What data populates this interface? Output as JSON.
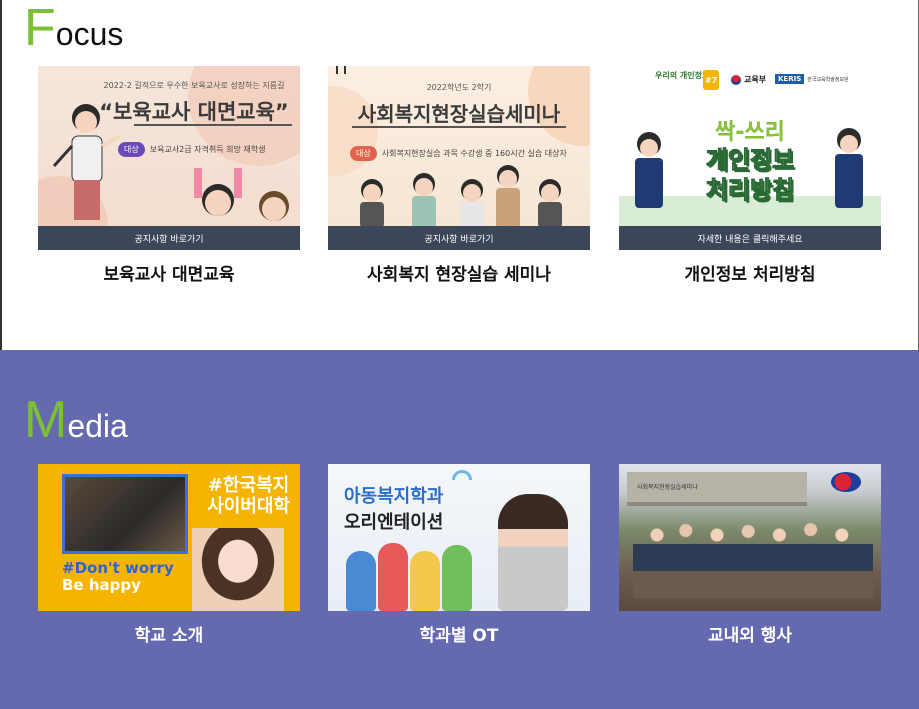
{
  "focus": {
    "title_initial": "F",
    "title_rest": "ocus",
    "cards": [
      {
        "sub_small": "2022-2 길적으로 우수한 보육교사로 성장하는 지름길",
        "headline": "“보육교사 대면교육”",
        "tag": "대상",
        "tag_text": "보육교사2급 자격취득 희망 재학생",
        "strip": "공지사항 바로가기",
        "caption": "보육교사 대면교육"
      },
      {
        "sub_small": "2022학년도 2학기",
        "headline": "사회복지현장실습세미나",
        "tag": "대상",
        "tag_text": "사회복지현장실습 과목 수강생 중 160시간 실습 대상자",
        "strip": "공지사항 바로가기",
        "caption": "사회복지 현장실습 세미나"
      },
      {
        "badge_top": "우리의 개인정보",
        "badge_num": "#7",
        "org1": "교육부",
        "org2": "KERIS",
        "org2_sub": "한국교육학술정보원",
        "headline1": "싹-쓰리",
        "headline2": "개인정보",
        "headline3": "처리방침",
        "strip": "자세한 내용은 클릭해주세요",
        "caption": "개인정보 처리방침"
      }
    ]
  },
  "media": {
    "title_initial": "M",
    "title_rest": "edia",
    "cards": [
      {
        "hash1_l1": "#한국복지",
        "hash1_l2": "사이버대학",
        "hash2_l1": "#Don't worry",
        "hash2_l2": "Be happy",
        "caption": "학교 소개"
      },
      {
        "title1": "아동복지학과",
        "title2": "오리엔테이션",
        "caption": "학과별 OT"
      },
      {
        "building_sign": "사회복지현장실습세미나",
        "caption": "교내외 행사"
      }
    ]
  },
  "colors": {
    "accent_green": "#7dbf34",
    "media_bg": "#6469b0",
    "strip_bg": "#3b4658"
  }
}
